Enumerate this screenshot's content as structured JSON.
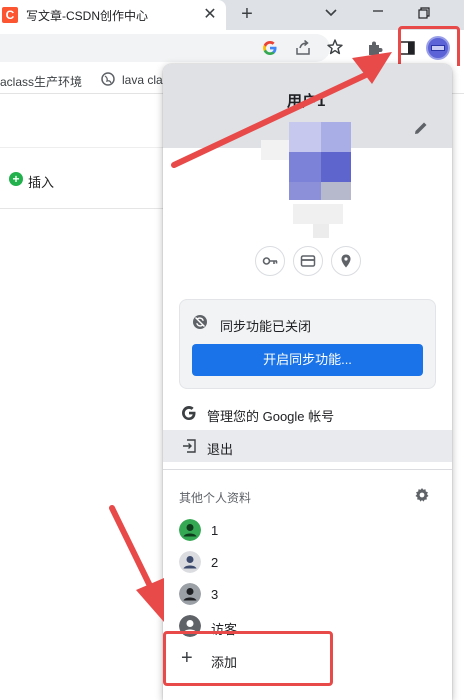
{
  "browser": {
    "tab_favicon_letter": "C",
    "tab_title": "写文章-CSDN创作中心",
    "tab_close": "✕",
    "new_tab": "+",
    "bookmarks": [
      {
        "label": "vaclass生产环境"
      },
      {
        "label": "lava cla"
      }
    ]
  },
  "page": {
    "insert_icon": "+",
    "insert_label": "插入"
  },
  "menu": {
    "user_name": "用户1",
    "sync_status": "同步功能已关闭",
    "sync_button": "开启同步功能...",
    "manage_account": "管理您的 Google 帐号",
    "sign_out": "退出",
    "other_profiles_title": "其他个人资料",
    "profiles": [
      {
        "label": "1",
        "color": "#34a853"
      },
      {
        "label": "2",
        "color": "#dadce0"
      },
      {
        "label": "3",
        "color": "#9aa0a6"
      },
      {
        "label": "访客",
        "color": "#5f6368"
      }
    ],
    "add_icon": "+",
    "add_label": "添加"
  },
  "colors": {
    "accent": "#1a73e8",
    "highlight_annotation": "#e84a4a",
    "csdn_brand": "#fc5531"
  }
}
